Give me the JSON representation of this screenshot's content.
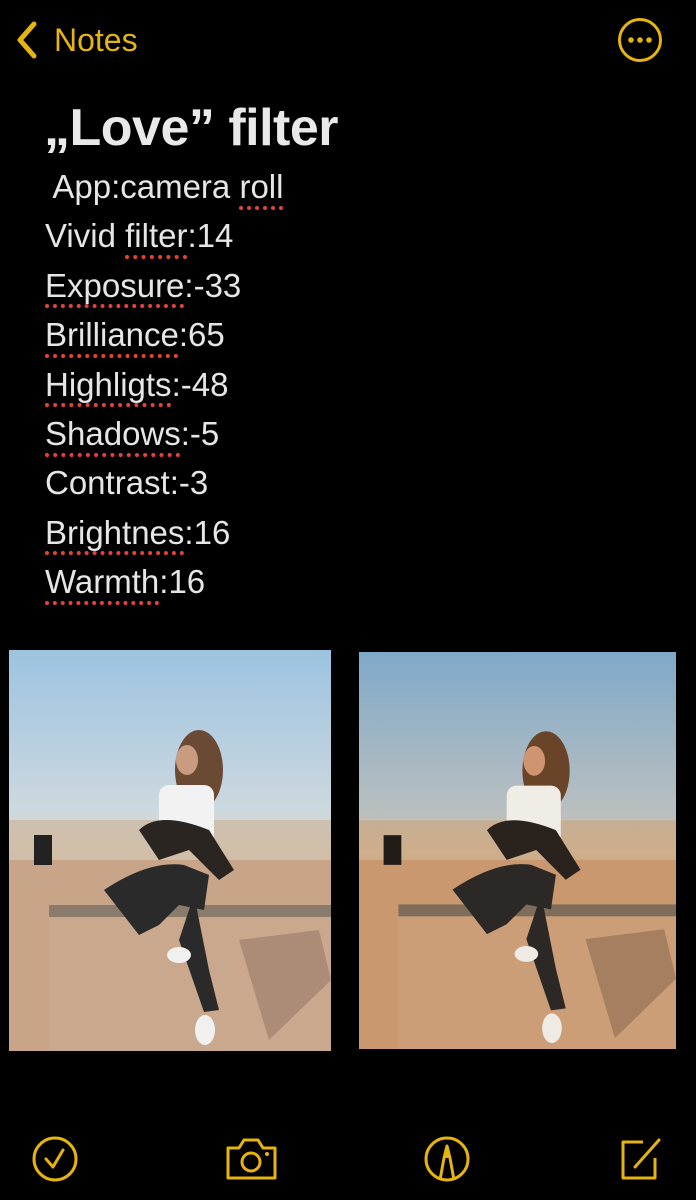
{
  "nav": {
    "back_label": "Notes",
    "more_icon": "ellipsis-circle-icon"
  },
  "note": {
    "title": "„Love” filter",
    "lines": [
      {
        "text": " App:camera ",
        "misspelled": "roll",
        "rest": ""
      },
      {
        "text": "Vivid ",
        "misspelled": "filter",
        "rest": ":14"
      },
      {
        "text": "",
        "misspelled": "Exposure",
        "rest": ":-33"
      },
      {
        "text": "",
        "misspelled": "Brilliance",
        "rest": ":65"
      },
      {
        "text": "",
        "misspelled": "Highligts",
        "rest": ":-48"
      },
      {
        "text": "",
        "misspelled": "Shadows",
        "rest": ":-5"
      },
      {
        "text": "Contrast:-3",
        "misspelled": "",
        "rest": ""
      },
      {
        "text": "",
        "misspelled": "Brightnes",
        "rest": ":16"
      },
      {
        "text": "",
        "misspelled": "Warmth",
        "rest": ":16"
      }
    ]
  },
  "images": [
    {
      "description": "Original photo: woman sitting on concrete skatepark ledge at sunset"
    },
    {
      "description": "Edited photo with warm 'Love' filter applied"
    }
  ],
  "toolbar": {
    "items": [
      {
        "icon": "checklist-icon"
      },
      {
        "icon": "camera-icon"
      },
      {
        "icon": "markup-pen-icon"
      },
      {
        "icon": "compose-icon"
      }
    ]
  },
  "colors": {
    "accent": "#e5b40f",
    "spellcheck": "#e8413b",
    "background": "#000000",
    "text": "#e6e6e6"
  }
}
